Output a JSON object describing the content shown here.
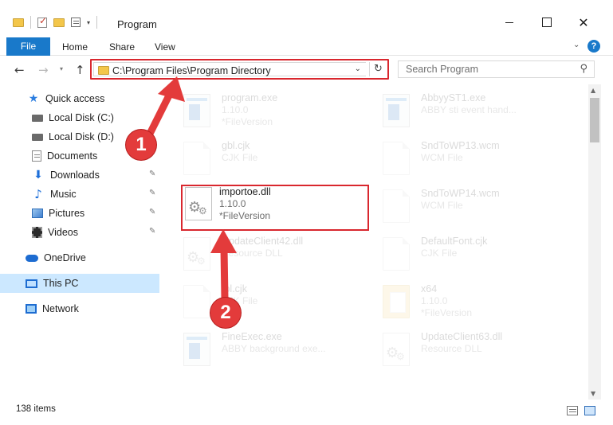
{
  "window": {
    "title": "Program"
  },
  "ribbon": {
    "file": "File",
    "home": "Home",
    "share": "Share",
    "view": "View",
    "help": "?"
  },
  "address": {
    "path": "C:\\Program Files\\Program Directory"
  },
  "search": {
    "placeholder": "Search Program"
  },
  "sidebar": {
    "items": [
      {
        "label": "Quick access"
      },
      {
        "label": "Local Disk (C:)"
      },
      {
        "label": "Local Disk (D:)"
      },
      {
        "label": "Documents"
      },
      {
        "label": "Downloads"
      },
      {
        "label": "Music"
      },
      {
        "label": "Pictures"
      },
      {
        "label": "Videos"
      },
      {
        "label": "OneDrive"
      },
      {
        "label": "This PC"
      },
      {
        "label": "Network"
      }
    ]
  },
  "files": [
    {
      "name": "program.exe",
      "line2": "1.10.0",
      "line3": "*FileVersion"
    },
    {
      "name": "AbbyyST1.exe",
      "line2": "ABBY sti event hand...",
      "line3": ""
    },
    {
      "name": "gbl.cjk",
      "line2": "CJK File",
      "line3": ""
    },
    {
      "name": "SndToWP13.wcm",
      "line2": "WCM File",
      "line3": ""
    },
    {
      "name": "importoe.dll",
      "line2": "1.10.0",
      "line3": "*FileVersion"
    },
    {
      "name": "SndToWP14.wcm",
      "line2": "WCM File",
      "line3": ""
    },
    {
      "name": "UpdateClient42.dll",
      "line2": "Resource DLL",
      "line3": ""
    },
    {
      "name": "DefaultFont.cjk",
      "line2": "CJK File",
      "line3": ""
    },
    {
      "name": "tbl.cjk",
      "line2": "CJK File",
      "line3": ""
    },
    {
      "name": "x64",
      "line2": "1.10.0",
      "line3": "*FileVersion"
    },
    {
      "name": "FineExec.exe",
      "line2": "ABBY background exe...",
      "line3": ""
    },
    {
      "name": "UpdateClient63.dll",
      "line2": "Resource DLL",
      "line3": ""
    }
  ],
  "status": {
    "count": "138 items"
  },
  "annotations": {
    "step1": "1",
    "step2": "2",
    "color": "#e33b3b"
  }
}
